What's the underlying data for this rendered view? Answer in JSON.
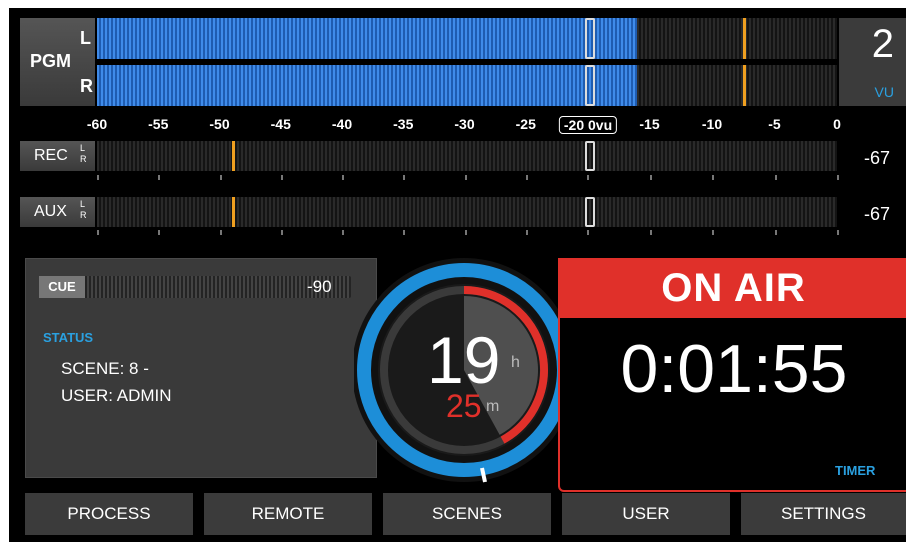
{
  "pgm": {
    "label": "PGM",
    "left_label": "L",
    "right_label": "R",
    "level_left_fraction": 0.73,
    "level_right_fraction": 0.73,
    "peak_db": -7.5,
    "vu_number": "2",
    "vu_unit": "VU"
  },
  "scale": {
    "ticks": [
      "-60",
      "-55",
      "-50",
      "-45",
      "-40",
      "-35",
      "-30",
      "-25",
      "-15",
      "-10",
      "-5",
      "0"
    ],
    "zero_ref": "-20 0vu"
  },
  "channels": [
    {
      "name": "REC",
      "left_label": "L",
      "right_label": "R",
      "value": "-67",
      "peak_db": -49
    },
    {
      "name": "AUX",
      "left_label": "L",
      "right_label": "R",
      "value": "-67",
      "peak_db": -49
    }
  ],
  "cue": {
    "label": "CUE",
    "value": "-90"
  },
  "status": {
    "title": "STATUS",
    "scene": "SCENE: 8 -",
    "user": "USER: ADMIN"
  },
  "clock": {
    "hours": "19",
    "hours_unit": "h",
    "minutes": "25",
    "minutes_unit": "m",
    "minutes_progress": 0.42
  },
  "onair": {
    "label": "ON AIR",
    "timer": "0:01:55",
    "timer_label": "TIMER",
    "color": "#e0302a"
  },
  "buttons": {
    "process": "PROCESS",
    "remote": "REMOTE",
    "scenes": "SCENES",
    "user": "USER",
    "settings": "SETTINGS"
  },
  "colors": {
    "meter_blue": "#2a6ed0",
    "peak_orange": "#f0a020",
    "accent_blue": "#2aa0e0",
    "onair_red": "#e0302a"
  }
}
